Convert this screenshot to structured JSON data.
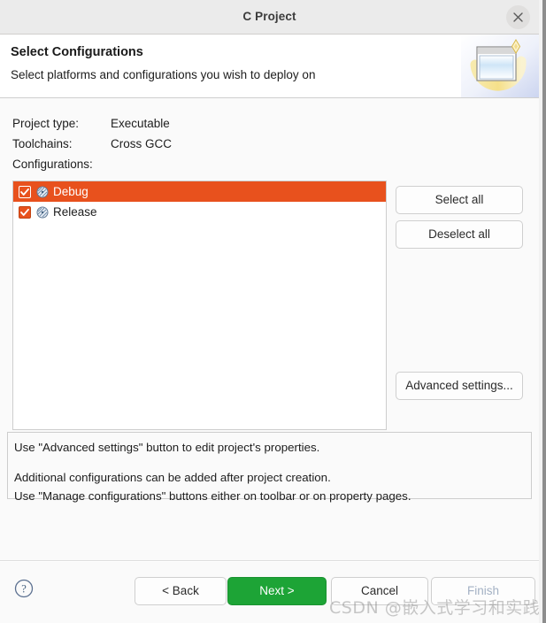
{
  "window": {
    "title": "C Project",
    "close_icon": "close-icon"
  },
  "header": {
    "title": "Select Configurations",
    "subtitle": "Select platforms and configurations you wish to deploy on",
    "icon": "wizard-window-sparkle-icon"
  },
  "project_info": {
    "rows": [
      {
        "label": "Project type:",
        "value": "Executable"
      },
      {
        "label": "Toolchains:",
        "value": "Cross GCC"
      },
      {
        "label": "Configurations:",
        "value": ""
      }
    ]
  },
  "configurations": {
    "items": [
      {
        "label": "Debug",
        "checked": true,
        "selected": true,
        "icon": "build-configuration-icon"
      },
      {
        "label": "Release",
        "checked": true,
        "selected": false,
        "icon": "build-configuration-icon"
      }
    ]
  },
  "side_buttons": {
    "select_all": "Select all",
    "deselect_all": "Deselect all",
    "advanced_settings": "Advanced settings..."
  },
  "info_panel": {
    "line1": "Use \"Advanced settings\" button to edit project's properties.",
    "line2": "Additional configurations can be added after project creation.",
    "line3": "Use \"Manage configurations\" buttons either on toolbar or on property pages."
  },
  "footer": {
    "help_icon": "help-question-icon",
    "back": "< Back",
    "next": "Next >",
    "cancel": "Cancel",
    "finish": "Finish"
  },
  "watermark": {
    "text": "CSDN @嵌入式学习和实践"
  },
  "colors": {
    "selection_orange": "#e8511d",
    "default_button_green": "#1da436",
    "disabled_text": "#a3b1c4",
    "titlebar_bg": "#ebebeb",
    "body_bg": "#fafafa"
  }
}
